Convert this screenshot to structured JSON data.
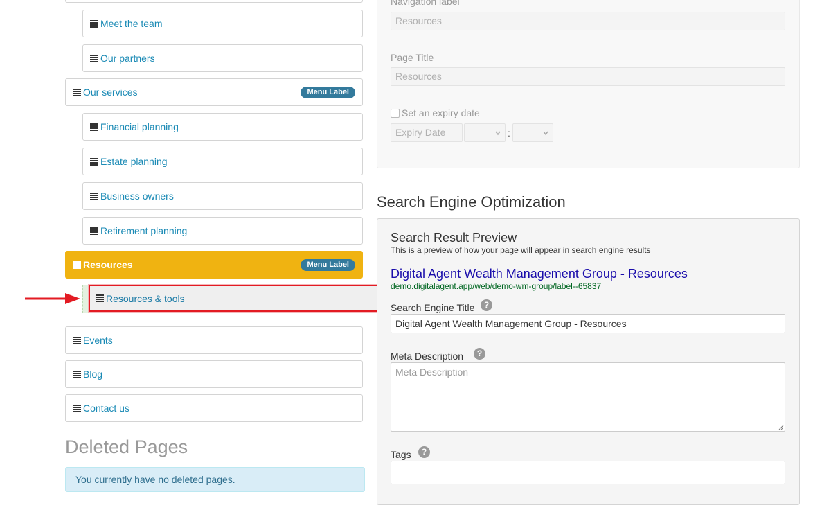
{
  "tree": {
    "items": [
      {
        "label": "Meet the team"
      },
      {
        "label": "Our partners"
      },
      {
        "label": "Our services",
        "badge": "Menu Label"
      },
      {
        "label": "Financial planning"
      },
      {
        "label": "Estate planning"
      },
      {
        "label": "Business owners"
      },
      {
        "label": "Retirement planning"
      },
      {
        "label": "Resources",
        "badge": "Menu Label"
      },
      {
        "label": "Events"
      },
      {
        "label": "Blog"
      },
      {
        "label": "Contact us"
      }
    ],
    "dragging_label": "Resources & tools"
  },
  "deleted": {
    "title": "Deleted Pages",
    "message": "You currently have no deleted pages."
  },
  "page_settings": {
    "nav_label_label": "Navigation label",
    "nav_label_value": "Resources",
    "page_title_label": "Page Title",
    "page_title_value": "Resources",
    "expiry_label": "Set an expiry date",
    "expiry_placeholder": "Expiry Date",
    "time_separator": ":"
  },
  "seo": {
    "heading": "Search Engine Optimization",
    "preview_title": "Search Result Preview",
    "preview_subtitle": "This is a preview of how your page will appear in search engine results",
    "preview_link": "Digital Agent Wealth Management Group - Resources",
    "preview_url": "demo.digitalagent.app/web/demo-wm-group/label--65837",
    "title_label": "Search Engine Title",
    "title_value": "Digital Agent Wealth Management Group - Resources",
    "meta_label": "Meta Description",
    "meta_placeholder": "Meta Description",
    "tags_label": "Tags",
    "help_glyph": "?"
  },
  "colors": {
    "active_item": "#f0b311",
    "badge": "#337a9c",
    "link": "#1a8ab5",
    "highlight_border": "#e31b23",
    "arrow": "#e31b23"
  }
}
